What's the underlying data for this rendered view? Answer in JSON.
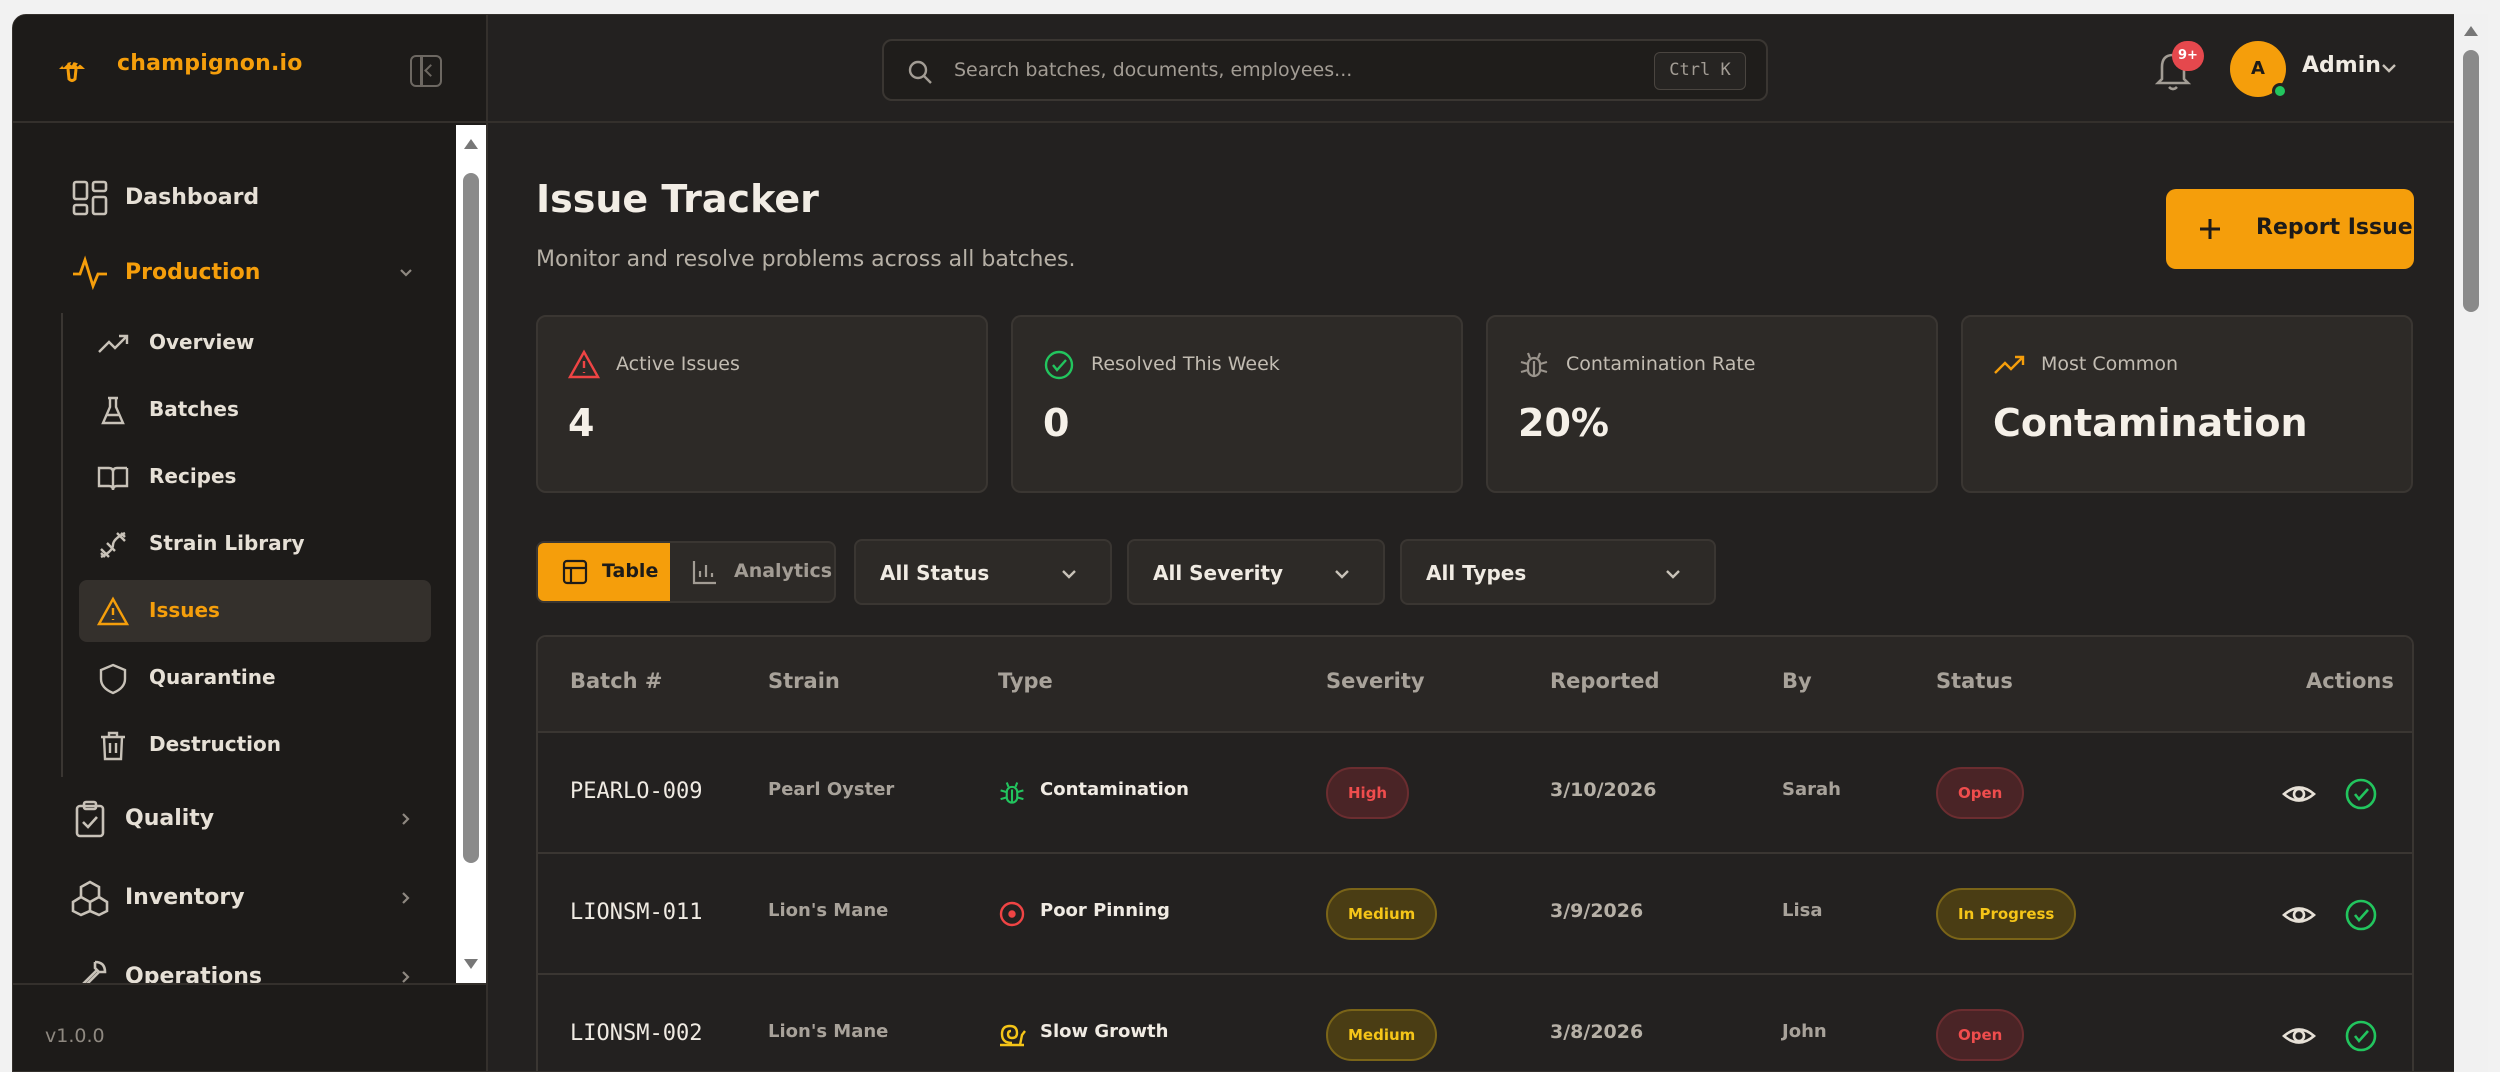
{
  "brand": {
    "name": "champignon.io"
  },
  "sidebar": {
    "items": [
      {
        "label": "Dashboard",
        "icon": "dashboard-grid-icon"
      },
      {
        "label": "Production",
        "icon": "activity-pulse-icon",
        "expanded": true
      },
      {
        "label": "Quality",
        "icon": "clipboard-check-icon"
      },
      {
        "label": "Inventory",
        "icon": "boxes-icon"
      },
      {
        "label": "Operations",
        "icon": "wrench-icon"
      }
    ],
    "sub_items": [
      {
        "label": "Overview",
        "icon": "trending-up-icon"
      },
      {
        "label": "Batches",
        "icon": "flask-icon"
      },
      {
        "label": "Recipes",
        "icon": "book-open-icon"
      },
      {
        "label": "Strain Library",
        "icon": "dna-icon"
      },
      {
        "label": "Issues",
        "icon": "alert-triangle-icon",
        "active": true
      },
      {
        "label": "Quarantine",
        "icon": "shield-icon"
      },
      {
        "label": "Destruction",
        "icon": "trash-icon"
      }
    ],
    "version": "v1.0.0"
  },
  "header": {
    "search_placeholder": "Search batches, documents, employees...",
    "shortcut": "Ctrl K",
    "notification_badge": "9+",
    "avatar_initial": "A",
    "user_name": "Admin"
  },
  "page": {
    "title": "Issue Tracker",
    "subtitle": "Monitor and resolve problems across all batches.",
    "report_button": "Report Issue"
  },
  "stats": [
    {
      "label": "Active Issues",
      "value": "4",
      "icon": "alert-triangle-icon",
      "color": "#ef4444"
    },
    {
      "label": "Resolved This Week",
      "value": "0",
      "icon": "check-circle-icon",
      "color": "#22c55e"
    },
    {
      "label": "Contamination Rate",
      "value": "20%",
      "icon": "bug-icon",
      "color": "#9a948c"
    },
    {
      "label": "Most Common",
      "value": "Contamination",
      "icon": "trending-up-icon",
      "color": "#f59e0b"
    }
  ],
  "view_toggle": {
    "table": "Table",
    "analytics": "Analytics"
  },
  "filters": {
    "status": "All Status",
    "severity": "All Severity",
    "types": "All Types"
  },
  "table": {
    "headers": [
      "Batch #",
      "Strain",
      "Type",
      "Severity",
      "Reported",
      "By",
      "Status",
      "Actions"
    ],
    "rows": [
      {
        "batch": "PEARLO-009",
        "strain": "Pearl Oyster",
        "type": "Contamination",
        "type_icon": "bug-icon",
        "severity": "High",
        "reported": "3/10/2026",
        "by": "Sarah",
        "status": "Open"
      },
      {
        "batch": "LIONSM-011",
        "strain": "Lion's Mane",
        "type": "Poor Pinning",
        "type_icon": "target-circle-icon",
        "severity": "Medium",
        "reported": "3/9/2026",
        "by": "Lisa",
        "status": "In Progress"
      },
      {
        "batch": "LIONSM-002",
        "strain": "Lion's Mane",
        "type": "Slow Growth",
        "type_icon": "snail-icon",
        "severity": "Medium",
        "reported": "3/8/2026",
        "by": "John",
        "status": "Open"
      }
    ]
  },
  "colors": {
    "accent": "#f59e0b",
    "danger": "#ef4444",
    "success": "#22c55e",
    "warning": "#f5c518"
  }
}
